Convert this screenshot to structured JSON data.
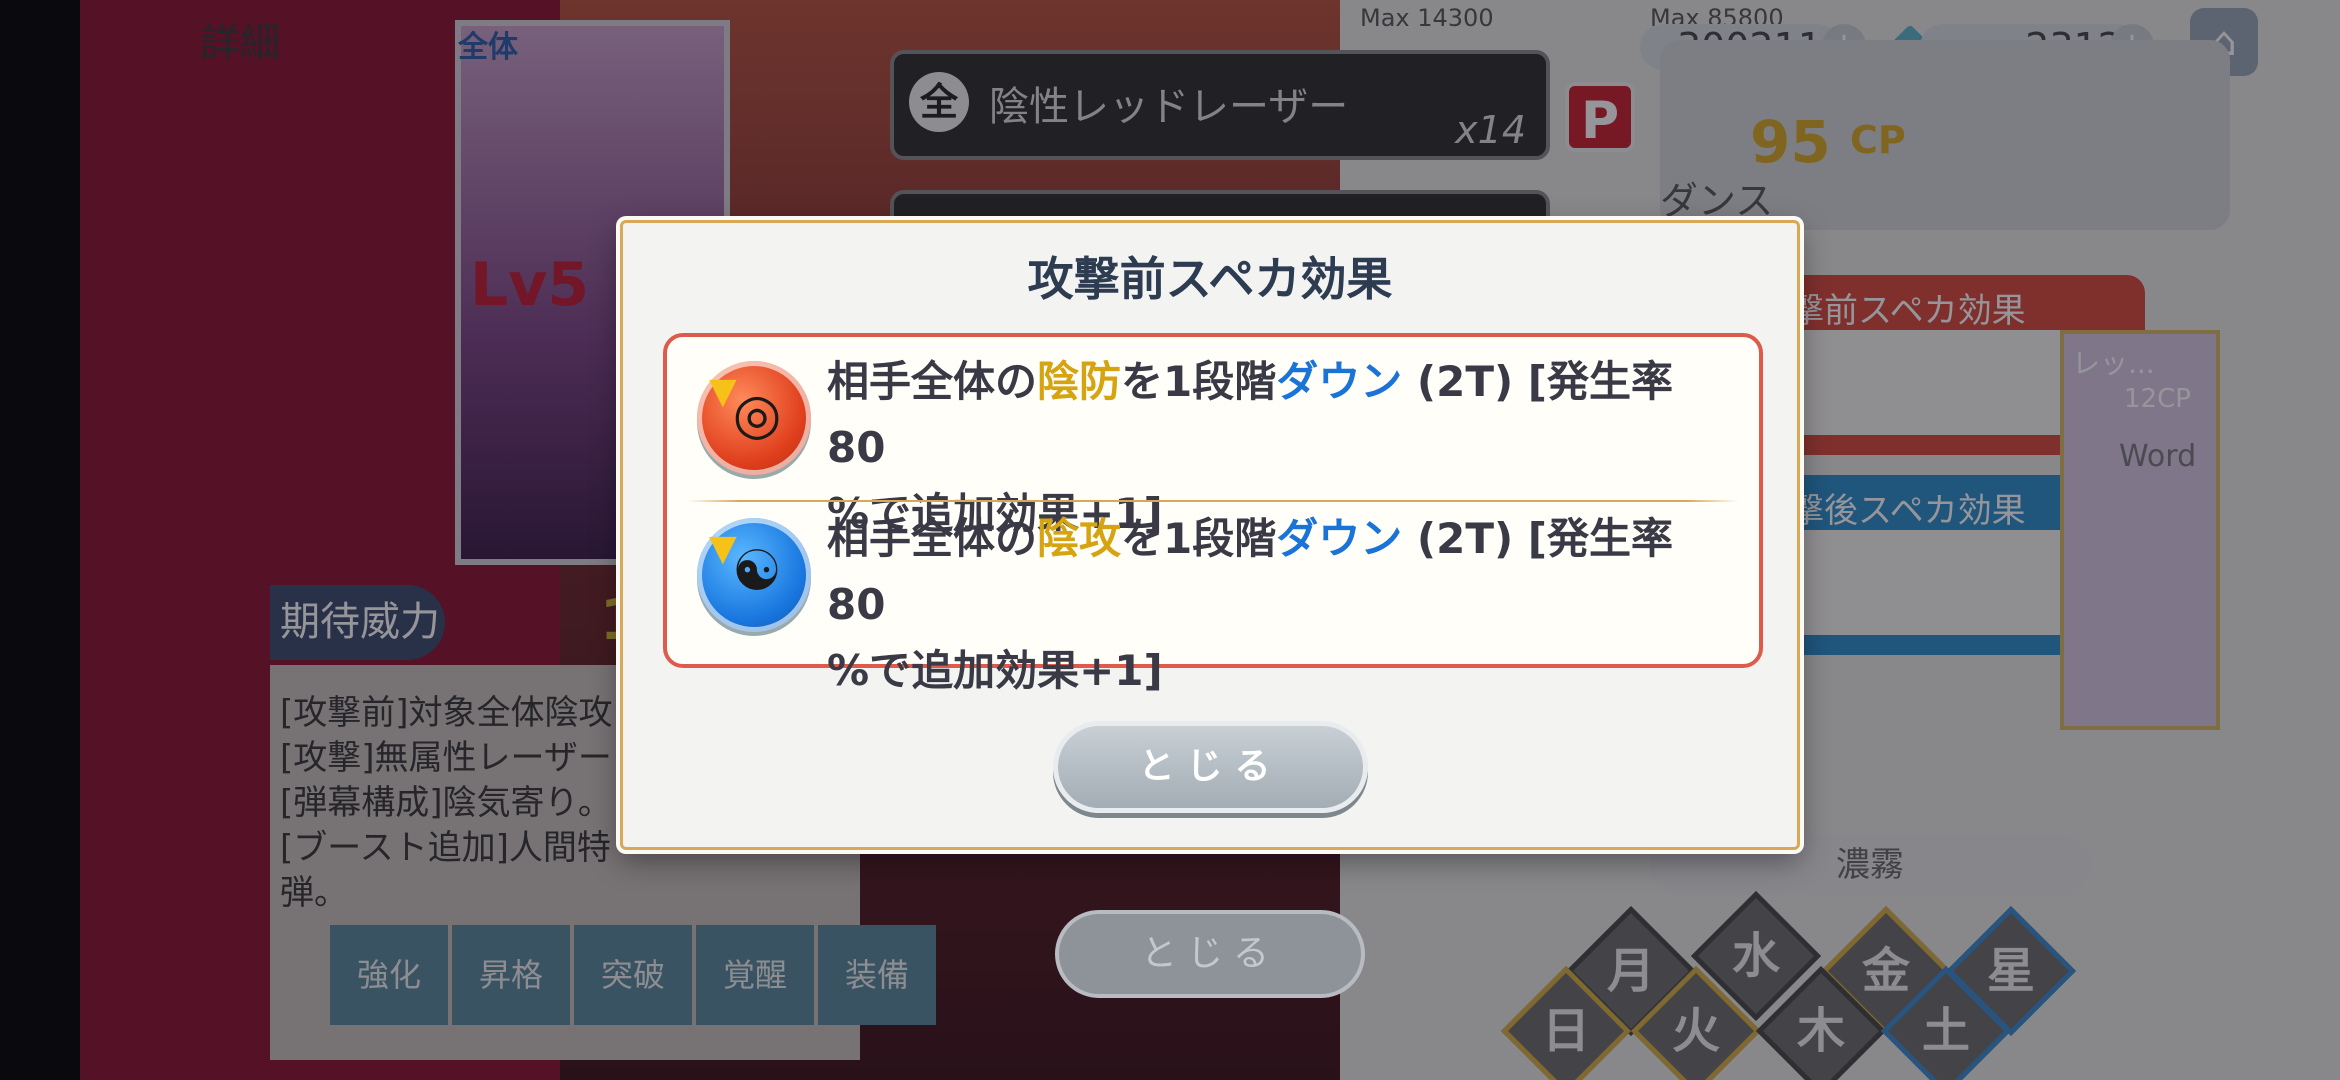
{
  "header": {
    "detail_label": "詳細",
    "counter1_max": "Max 14300",
    "counter2_max": "Max 85800",
    "counter2_value": "300211",
    "counter3_value": "2312",
    "plus": "+",
    "home_icon": "home-icon"
  },
  "card": {
    "scope": "全体",
    "level": "Lv5"
  },
  "skill": {
    "scope_badge": "全",
    "name": "陰性レッドレーザー",
    "count": "x14",
    "p_badge": "P"
  },
  "cp": {
    "value": "95",
    "unit": "CP",
    "dance": "ダンス"
  },
  "side_panels": {
    "before_title": "撃前スペカ効果",
    "after_title": "撃後スペカ効果",
    "card_a": "レッ...",
    "card_b": "12CP",
    "card_c": "Word"
  },
  "expect": {
    "label": "期待威力",
    "value": "1"
  },
  "description": [
    "[攻撃前]対象全体陰攻",
    "[攻撃]無属性レーザー",
    "[弾幕構成]陰気寄り。",
    "[ブースト追加]人間特",
    "弾。"
  ],
  "bottom_tabs": [
    "強化",
    "昇格",
    "突破",
    "覚醒",
    "装備"
  ],
  "snow_label": "濃霧",
  "elements": [
    "月",
    "水",
    "金",
    "星",
    "日",
    "火",
    "木",
    "土"
  ],
  "background_close": "とじる",
  "modal": {
    "title": "攻撃前スペカ効果",
    "effects": [
      {
        "icon": "defense-down-icon",
        "prefix": "相手全体の",
        "stat": "陰防",
        "mid": "を1段階",
        "verb": "ダウン",
        "suffix_line1": " (2T) [発生率80",
        "line2": "%で追加効果+1]"
      },
      {
        "icon": "attack-down-icon",
        "prefix": "相手全体の",
        "stat": "陰攻",
        "mid": "を1段階",
        "verb": "ダウン",
        "suffix_line1": " (2T) [発生率80",
        "line2": "%で追加効果+1]"
      }
    ],
    "close_label": "とじる"
  },
  "colors": {
    "accent_yellow": "#d6a410",
    "accent_blue": "#1a74d8",
    "frame_red": "#de5a4c",
    "frame_gold": "#d8a858"
  }
}
